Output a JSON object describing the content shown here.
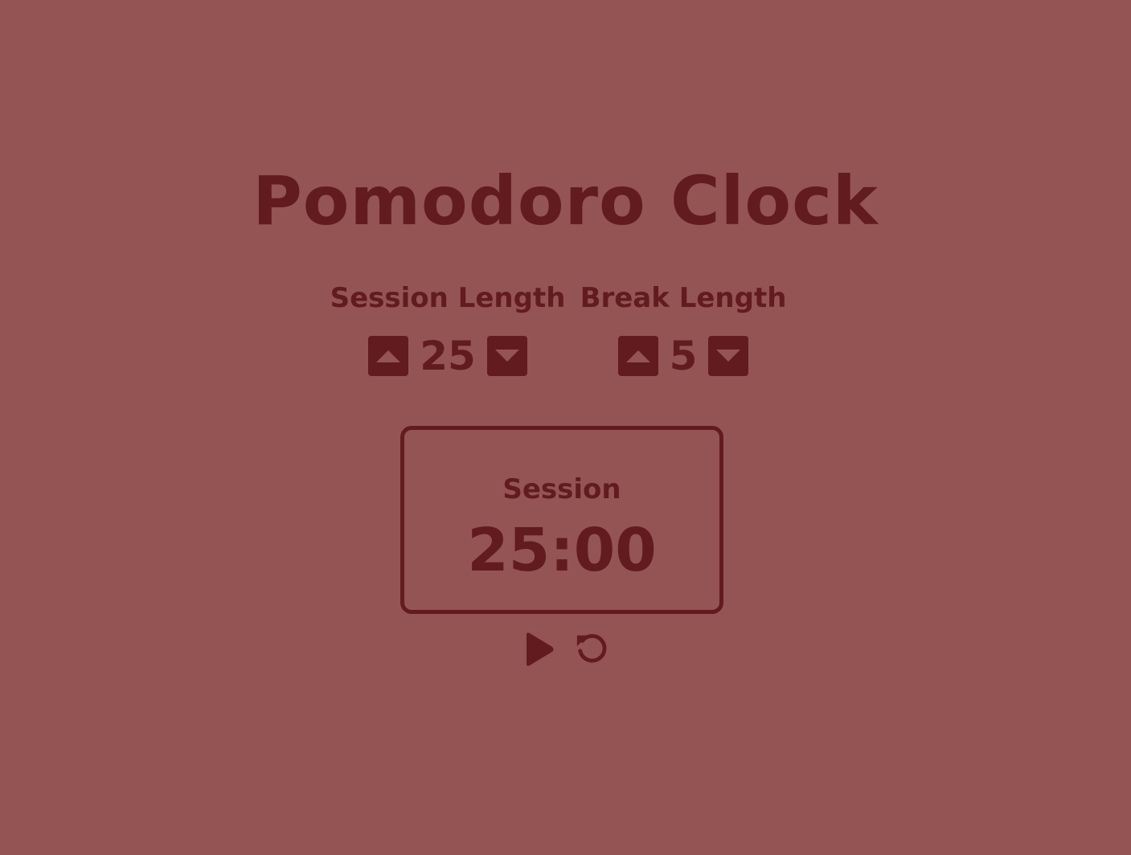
{
  "app": {
    "title": "Pomodoro Clock",
    "colors": {
      "background": "#945454",
      "foreground": "#621b1e"
    }
  },
  "session_setting": {
    "label": "Session Length",
    "value": "25",
    "increment_icon": "caret-up-icon",
    "decrement_icon": "caret-down-icon"
  },
  "break_setting": {
    "label": "Break Length",
    "value": "5",
    "increment_icon": "caret-up-icon",
    "decrement_icon": "caret-down-icon"
  },
  "timer": {
    "label": "Session",
    "time": "25:00"
  },
  "playback": {
    "play_icon": "play-icon",
    "reset_icon": "reset-icon"
  }
}
